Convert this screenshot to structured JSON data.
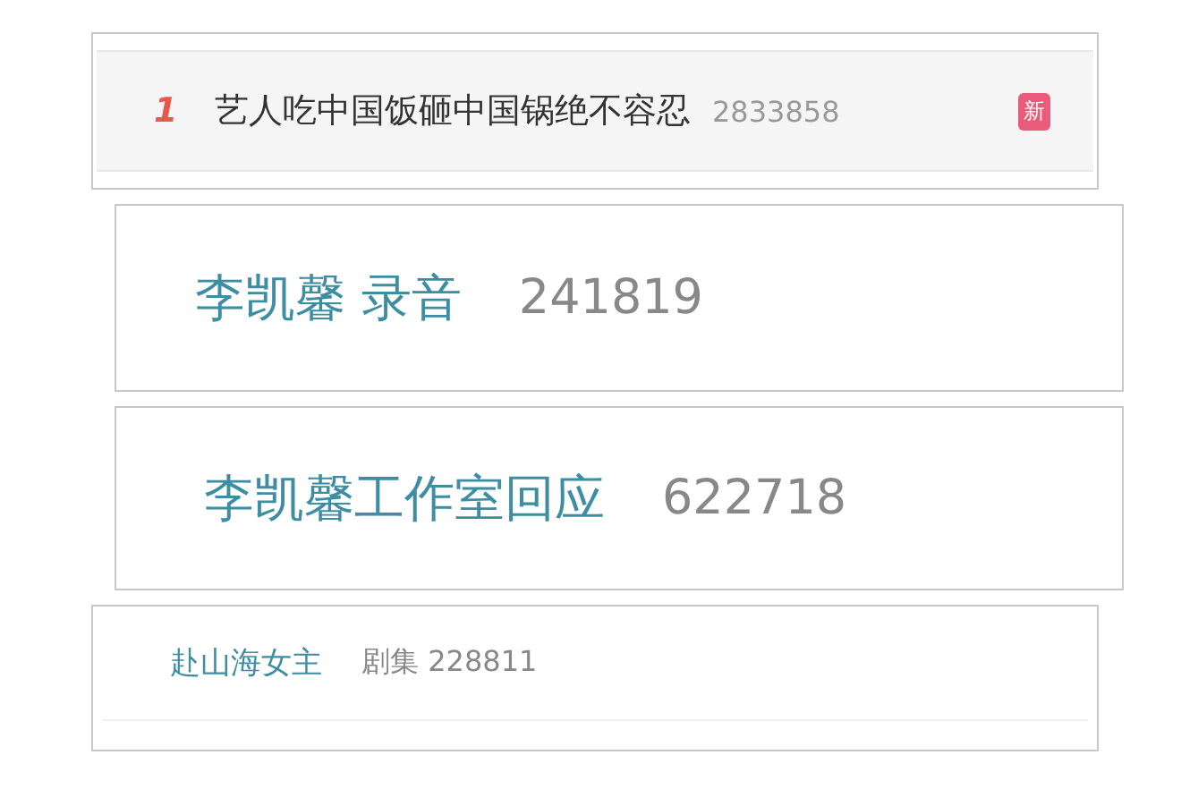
{
  "entries": [
    {
      "kind": "ranked",
      "rank": "1",
      "title": "艺人吃中国饭砸中国锅绝不容忍",
      "count": "2833858",
      "badge": "新"
    },
    {
      "kind": "large",
      "title": "李凯馨 录音",
      "count": "241819"
    },
    {
      "kind": "large",
      "title": "李凯馨工作室回应",
      "count": "622718"
    },
    {
      "kind": "category",
      "title": "赴山海女主",
      "category": "剧集",
      "count": "228811"
    }
  ]
}
